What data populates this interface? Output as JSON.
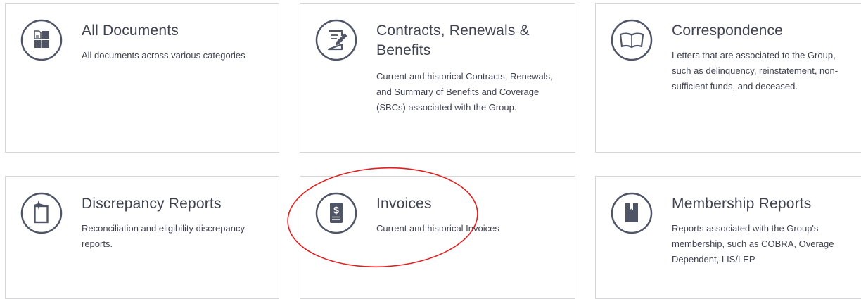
{
  "cards": [
    {
      "title": "All Documents",
      "description": "All documents across various categories",
      "icon": "documents-grid-icon"
    },
    {
      "title": "Contracts, Renewals & Benefits",
      "description": "Current and historical Contracts, Renewals, and Summary of Benefits and Coverage (SBCs) associated with the Group.",
      "icon": "pencil-on-paper-icon"
    },
    {
      "title": "Correspondence",
      "description": "Letters that are associated to the Group, such as delinquency, reinstatement, non-sufficient funds, and deceased.",
      "icon": "open-book-icon"
    },
    {
      "title": "Discrepancy Reports",
      "description": "Reconciliation and eligibility discrepancy reports.",
      "icon": "sparkle-document-icon"
    },
    {
      "title": "Invoices",
      "description": "Current and historical Invoices",
      "icon": "dollar-invoice-icon"
    },
    {
      "title": "Membership Reports",
      "description": "Reports associated with the Group's membership, such as COBRA, Overage Dependent, LIS/LEP",
      "icon": "bookmark-icon"
    }
  ],
  "colors": {
    "text": "#3f4350",
    "icon": "#4f5566",
    "border": "#d6d6d9",
    "annotation": "#e02020"
  }
}
